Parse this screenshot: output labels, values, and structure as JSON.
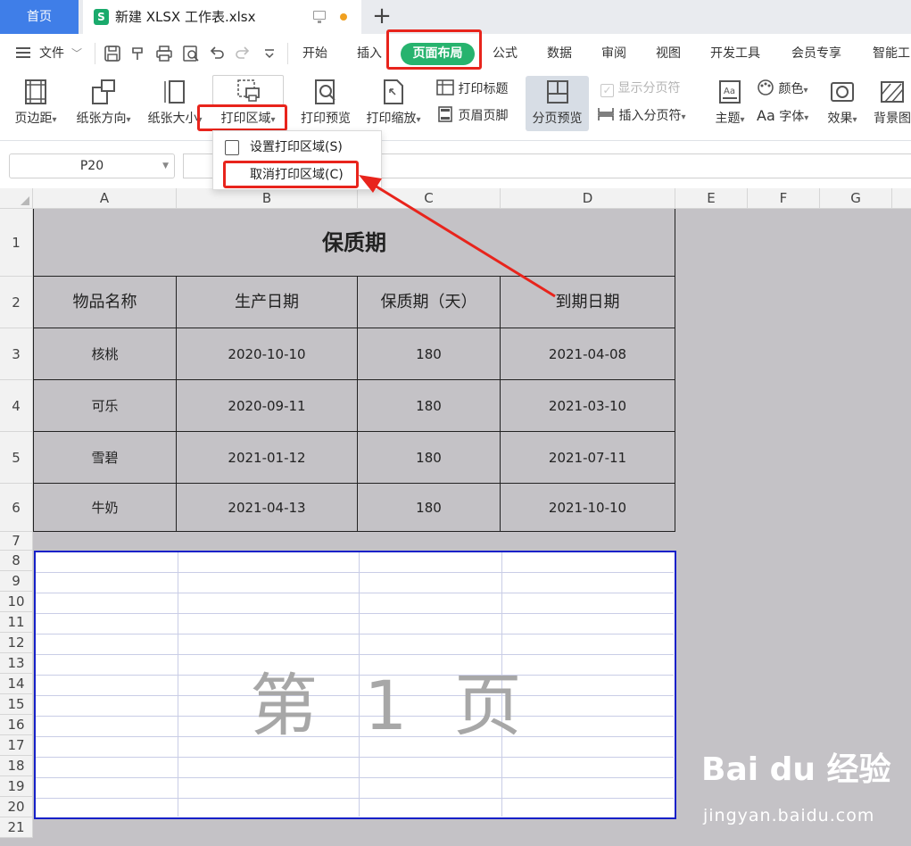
{
  "tabs": {
    "home": "首页",
    "doc_icon_letter": "S",
    "doc_title": "新建 XLSX 工作表.xlsx",
    "new_tab": "+"
  },
  "menu": {
    "file": "文件",
    "file_caret": "﹀",
    "items": [
      "开始",
      "插入",
      "页面布局",
      "公式",
      "数据",
      "审阅",
      "视图",
      "开发工具",
      "会员专享",
      "智能工"
    ]
  },
  "ribbon": {
    "margins": "页边距",
    "orientation": "纸张方向",
    "size": "纸张大小",
    "print_area": "打印区域",
    "print_preview": "打印预览",
    "print_scale": "打印缩放",
    "print_titles": "打印标题",
    "header_footer": "页眉页脚",
    "page_break_preview": "分页预览",
    "show_page_breaks": "显示分页符",
    "insert_page_break": "插入分页符",
    "theme": "主题",
    "colors": "颜色",
    "fonts": "字体",
    "fonts_prefix": "Aa",
    "effects": "效果",
    "background": "背景图",
    "caret": "▾"
  },
  "dropdown": {
    "set_print_area": "设置打印区域(S)",
    "clear_print_area": "取消打印区域(C)"
  },
  "formula_bar": {
    "cell_ref": "P20",
    "formula": ""
  },
  "columns": [
    "A",
    "B",
    "C",
    "D",
    "E",
    "F",
    "G"
  ],
  "rows": [
    "1",
    "2",
    "3",
    "4",
    "5",
    "6",
    "7",
    "8",
    "9",
    "10",
    "11",
    "12",
    "13",
    "14",
    "15",
    "16",
    "17",
    "18",
    "19",
    "20",
    "21"
  ],
  "sheet": {
    "title": "保质期",
    "headers": [
      "物品名称",
      "生产日期",
      "保质期（天）",
      "到期日期"
    ],
    "data": [
      [
        "核桃",
        "2020-10-10",
        "180",
        "2021-04-08"
      ],
      [
        "可乐",
        "2020-09-11",
        "180",
        "2021-03-10"
      ],
      [
        "雪碧",
        "2021-01-12",
        "180",
        "2021-07-11"
      ],
      [
        "牛奶",
        "2021-04-13",
        "180",
        "2021-10-10"
      ]
    ]
  },
  "page_label": "第 1 页",
  "watermark": {
    "brand": "Bai du 经验",
    "url": "jingyan.baidu.com"
  },
  "colors": {
    "accent_green": "#27b36e",
    "highlight_red": "#e8241c",
    "print_area_border": "#1520c8",
    "home_tab_blue": "#3f7ee8"
  }
}
